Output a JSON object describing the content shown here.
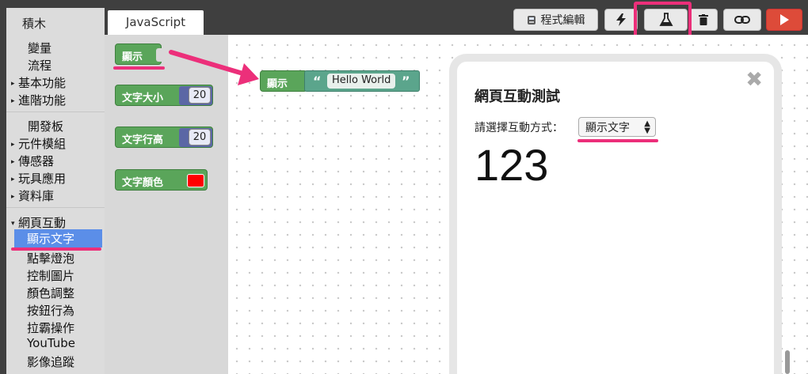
{
  "tabs": {
    "blocks": "積木",
    "javascript": "JavaScript"
  },
  "toolbar": {
    "code_edit_label": "程式編輯"
  },
  "sidebar": {
    "items": [
      {
        "label": "變量",
        "arrow": ""
      },
      {
        "label": "流程",
        "arrow": ""
      },
      {
        "label": "基本功能",
        "arrow": "▸"
      },
      {
        "label": "進階功能",
        "arrow": "▸"
      },
      {
        "label": "開發板",
        "arrow": ""
      },
      {
        "label": "元件模組",
        "arrow": "▸"
      },
      {
        "label": "傳感器",
        "arrow": "▸"
      },
      {
        "label": "玩具應用",
        "arrow": "▸"
      },
      {
        "label": "資料庫",
        "arrow": "▸"
      },
      {
        "label": "網頁互動",
        "arrow": "▾"
      }
    ],
    "selected": "顯示文字",
    "subitems": [
      "點擊燈泡",
      "控制圖片",
      "顏色調整",
      "按鈕行為",
      "拉霸操作",
      "YouTube",
      "影像追蹤"
    ]
  },
  "flyout": {
    "show_block": "顯示",
    "font_size_block": "文字大小",
    "font_size_value": "20",
    "line_height_block": "文字行高",
    "line_height_value": "20",
    "font_color_block": "文字顏色",
    "font_color_value": "#ff0000"
  },
  "workspace": {
    "show_block": "顯示",
    "text_value": "Hello World",
    "open_quote": "“",
    "close_quote": "”"
  },
  "panel": {
    "title": "網頁互動測試",
    "prompt": "請選擇互動方式：",
    "select_value": "顯示文字",
    "display_value": "123",
    "close": "✖"
  },
  "colors": {
    "accent": "#ec2f7a",
    "block_green": "#5aa55a",
    "block_teal": "#5ba58c",
    "run_red": "#dd4b39",
    "selected_blue": "#5b8ee8"
  }
}
